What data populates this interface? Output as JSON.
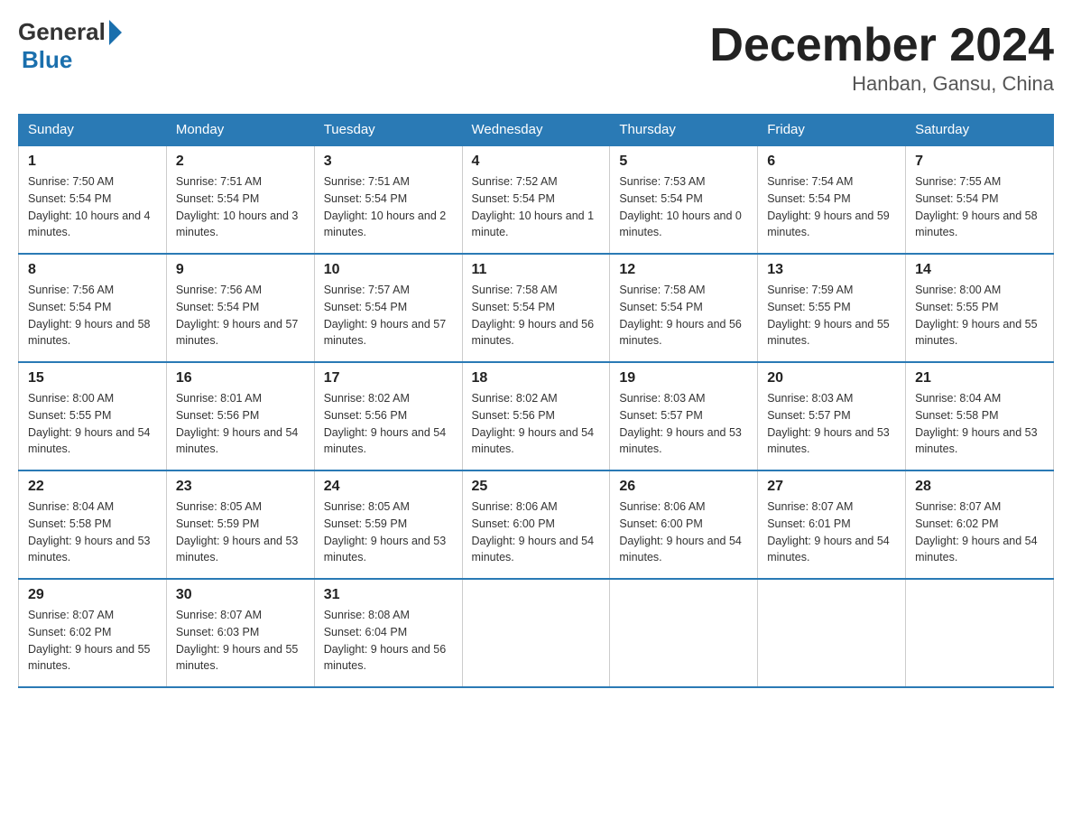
{
  "header": {
    "logo_general": "General",
    "logo_blue": "Blue",
    "month_title": "December 2024",
    "location": "Hanban, Gansu, China"
  },
  "days_of_week": [
    "Sunday",
    "Monday",
    "Tuesday",
    "Wednesday",
    "Thursday",
    "Friday",
    "Saturday"
  ],
  "weeks": [
    [
      {
        "day": "1",
        "sunrise": "7:50 AM",
        "sunset": "5:54 PM",
        "daylight": "10 hours and 4 minutes."
      },
      {
        "day": "2",
        "sunrise": "7:51 AM",
        "sunset": "5:54 PM",
        "daylight": "10 hours and 3 minutes."
      },
      {
        "day": "3",
        "sunrise": "7:51 AM",
        "sunset": "5:54 PM",
        "daylight": "10 hours and 2 minutes."
      },
      {
        "day": "4",
        "sunrise": "7:52 AM",
        "sunset": "5:54 PM",
        "daylight": "10 hours and 1 minute."
      },
      {
        "day": "5",
        "sunrise": "7:53 AM",
        "sunset": "5:54 PM",
        "daylight": "10 hours and 0 minutes."
      },
      {
        "day": "6",
        "sunrise": "7:54 AM",
        "sunset": "5:54 PM",
        "daylight": "9 hours and 59 minutes."
      },
      {
        "day": "7",
        "sunrise": "7:55 AM",
        "sunset": "5:54 PM",
        "daylight": "9 hours and 58 minutes."
      }
    ],
    [
      {
        "day": "8",
        "sunrise": "7:56 AM",
        "sunset": "5:54 PM",
        "daylight": "9 hours and 58 minutes."
      },
      {
        "day": "9",
        "sunrise": "7:56 AM",
        "sunset": "5:54 PM",
        "daylight": "9 hours and 57 minutes."
      },
      {
        "day": "10",
        "sunrise": "7:57 AM",
        "sunset": "5:54 PM",
        "daylight": "9 hours and 57 minutes."
      },
      {
        "day": "11",
        "sunrise": "7:58 AM",
        "sunset": "5:54 PM",
        "daylight": "9 hours and 56 minutes."
      },
      {
        "day": "12",
        "sunrise": "7:58 AM",
        "sunset": "5:54 PM",
        "daylight": "9 hours and 56 minutes."
      },
      {
        "day": "13",
        "sunrise": "7:59 AM",
        "sunset": "5:55 PM",
        "daylight": "9 hours and 55 minutes."
      },
      {
        "day": "14",
        "sunrise": "8:00 AM",
        "sunset": "5:55 PM",
        "daylight": "9 hours and 55 minutes."
      }
    ],
    [
      {
        "day": "15",
        "sunrise": "8:00 AM",
        "sunset": "5:55 PM",
        "daylight": "9 hours and 54 minutes."
      },
      {
        "day": "16",
        "sunrise": "8:01 AM",
        "sunset": "5:56 PM",
        "daylight": "9 hours and 54 minutes."
      },
      {
        "day": "17",
        "sunrise": "8:02 AM",
        "sunset": "5:56 PM",
        "daylight": "9 hours and 54 minutes."
      },
      {
        "day": "18",
        "sunrise": "8:02 AM",
        "sunset": "5:56 PM",
        "daylight": "9 hours and 54 minutes."
      },
      {
        "day": "19",
        "sunrise": "8:03 AM",
        "sunset": "5:57 PM",
        "daylight": "9 hours and 53 minutes."
      },
      {
        "day": "20",
        "sunrise": "8:03 AM",
        "sunset": "5:57 PM",
        "daylight": "9 hours and 53 minutes."
      },
      {
        "day": "21",
        "sunrise": "8:04 AM",
        "sunset": "5:58 PM",
        "daylight": "9 hours and 53 minutes."
      }
    ],
    [
      {
        "day": "22",
        "sunrise": "8:04 AM",
        "sunset": "5:58 PM",
        "daylight": "9 hours and 53 minutes."
      },
      {
        "day": "23",
        "sunrise": "8:05 AM",
        "sunset": "5:59 PM",
        "daylight": "9 hours and 53 minutes."
      },
      {
        "day": "24",
        "sunrise": "8:05 AM",
        "sunset": "5:59 PM",
        "daylight": "9 hours and 53 minutes."
      },
      {
        "day": "25",
        "sunrise": "8:06 AM",
        "sunset": "6:00 PM",
        "daylight": "9 hours and 54 minutes."
      },
      {
        "day": "26",
        "sunrise": "8:06 AM",
        "sunset": "6:00 PM",
        "daylight": "9 hours and 54 minutes."
      },
      {
        "day": "27",
        "sunrise": "8:07 AM",
        "sunset": "6:01 PM",
        "daylight": "9 hours and 54 minutes."
      },
      {
        "day": "28",
        "sunrise": "8:07 AM",
        "sunset": "6:02 PM",
        "daylight": "9 hours and 54 minutes."
      }
    ],
    [
      {
        "day": "29",
        "sunrise": "8:07 AM",
        "sunset": "6:02 PM",
        "daylight": "9 hours and 55 minutes."
      },
      {
        "day": "30",
        "sunrise": "8:07 AM",
        "sunset": "6:03 PM",
        "daylight": "9 hours and 55 minutes."
      },
      {
        "day": "31",
        "sunrise": "8:08 AM",
        "sunset": "6:04 PM",
        "daylight": "9 hours and 56 minutes."
      },
      null,
      null,
      null,
      null
    ]
  ],
  "labels": {
    "sunrise": "Sunrise:",
    "sunset": "Sunset:",
    "daylight": "Daylight:"
  }
}
